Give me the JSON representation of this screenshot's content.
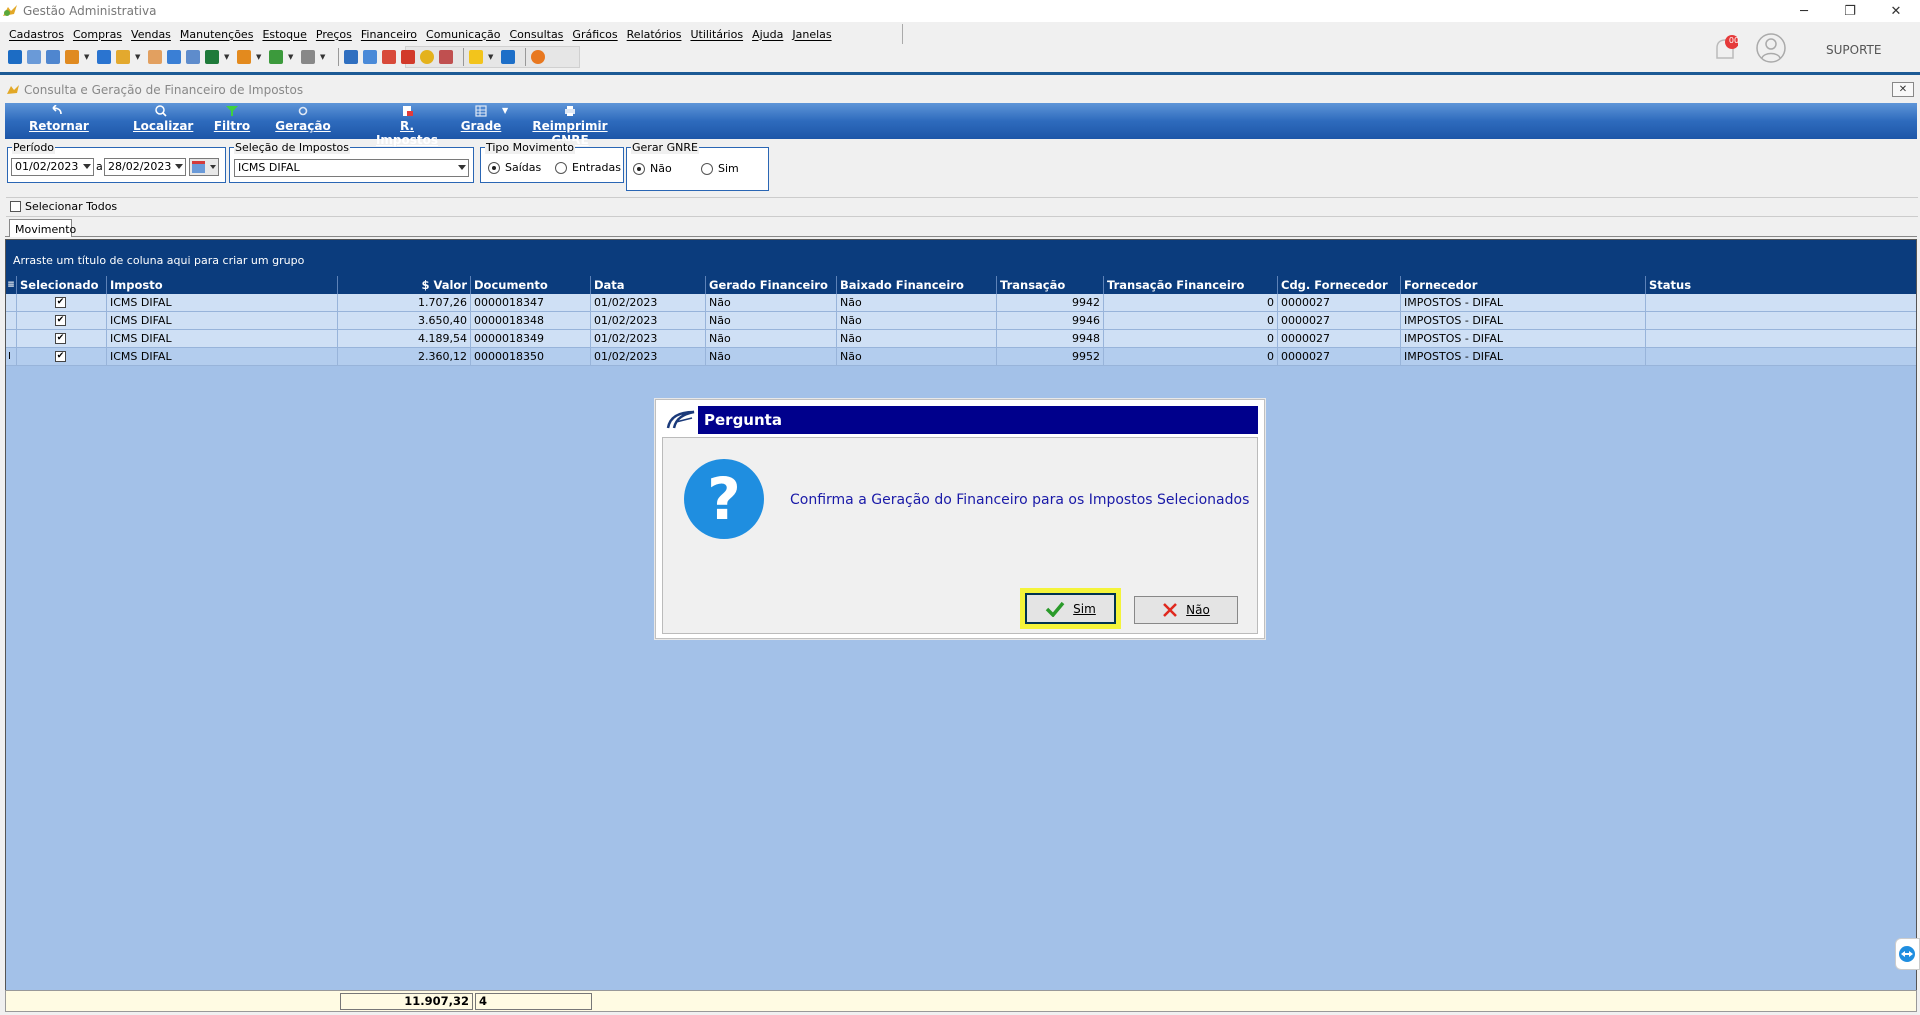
{
  "app": {
    "title": "Gestão Administrativa"
  },
  "window_controls": {
    "minimize": "─",
    "restore": "❐",
    "close": "✕"
  },
  "menu": [
    "Cadastros",
    "Compras",
    "Vendas",
    "Manutenções",
    "Estoque",
    "Preços",
    "Financeiro",
    "Comunicação",
    "Consultas",
    "Gráficos",
    "Relatórios",
    "Utilitários",
    "Ajuda",
    "Janelas"
  ],
  "header": {
    "notification_count": "00",
    "user": "SUPORTE"
  },
  "child": {
    "title": "Consulta e Geração de Financeiro de Impostos",
    "close": "✕"
  },
  "ribbon": {
    "retornar": "Retornar",
    "localizar": "Localizar",
    "filtro": "Filtro",
    "geracao": "Geração",
    "r_impostos": "R. Impostos",
    "grade": "Grade",
    "reimprimir": "Reimprimir GNRE"
  },
  "filters": {
    "periodo_label": "Período",
    "data_inicio": "01/02/2023",
    "separador": "a",
    "data_fim": "28/02/2023",
    "selecao_label": "Seleção de Impostos",
    "selecao_value": "ICMS DIFAL",
    "tipo_label": "Tipo Movimento",
    "saidas": "Saídas",
    "entradas": "Entradas",
    "tipo_selected": "Saídas",
    "gnre_label": "Gerar GNRE",
    "nao": "Não",
    "sim": "Sim",
    "gnre_selected": "Não",
    "selecionar_todos": "Selecionar Todos"
  },
  "tabs": {
    "movimento": "Movimento"
  },
  "grid": {
    "group_hint": "Arraste um título de coluna aqui para criar um grupo",
    "columns": [
      "Selecionado",
      "Imposto",
      "$ Valor",
      "Documento",
      "Data",
      "Gerado Financeiro",
      "Baixado Financeiro",
      "Transação",
      "Transação Financeiro",
      "Cdg. Fornecedor",
      "Fornecedor",
      "Status"
    ],
    "rows": [
      {
        "selecionado": "✔",
        "imposto": "ICMS DIFAL",
        "valor": "1.707,26",
        "documento": "0000018347",
        "data": "01/02/2023",
        "gerado": "Não",
        "baixado": "Não",
        "transacao": "9942",
        "transacao_fin": "0",
        "cdg_fornecedor": "0000027",
        "fornecedor": "IMPOSTOS - DIFAL",
        "status": ""
      },
      {
        "selecionado": "✔",
        "imposto": "ICMS DIFAL",
        "valor": "3.650,40",
        "documento": "0000018348",
        "data": "01/02/2023",
        "gerado": "Não",
        "baixado": "Não",
        "transacao": "9946",
        "transacao_fin": "0",
        "cdg_fornecedor": "0000027",
        "fornecedor": "IMPOSTOS - DIFAL",
        "status": ""
      },
      {
        "selecionado": "✔",
        "imposto": "ICMS DIFAL",
        "valor": "4.189,54",
        "documento": "0000018349",
        "data": "01/02/2023",
        "gerado": "Não",
        "baixado": "Não",
        "transacao": "9948",
        "transacao_fin": "0",
        "cdg_fornecedor": "0000027",
        "fornecedor": "IMPOSTOS - DIFAL",
        "status": ""
      },
      {
        "selecionado": "✔",
        "imposto": "ICMS DIFAL",
        "valor": "2.360,12",
        "documento": "0000018350",
        "data": "01/02/2023",
        "gerado": "Não",
        "baixado": "Não",
        "transacao": "9952",
        "transacao_fin": "0",
        "cdg_fornecedor": "0000027",
        "fornecedor": "IMPOSTOS - DIFAL",
        "status": ""
      }
    ],
    "row_indicator_cursor": "I"
  },
  "footer": {
    "total_valor": "11.907,32",
    "count": "4"
  },
  "dialog": {
    "title": "Pergunta",
    "icon": "?",
    "message": "Confirma a Geração do Financeiro para os Impostos Selecionados",
    "sim": "Sim",
    "nao": "Não"
  },
  "colors": {
    "ribbon": "#2e6bbd",
    "grid_header": "#0b3c7d",
    "grid_bg": "#a3c1e8",
    "dialog_bar": "#00008c",
    "highlight": "#f4f43a",
    "question": "#1f8ee0"
  }
}
